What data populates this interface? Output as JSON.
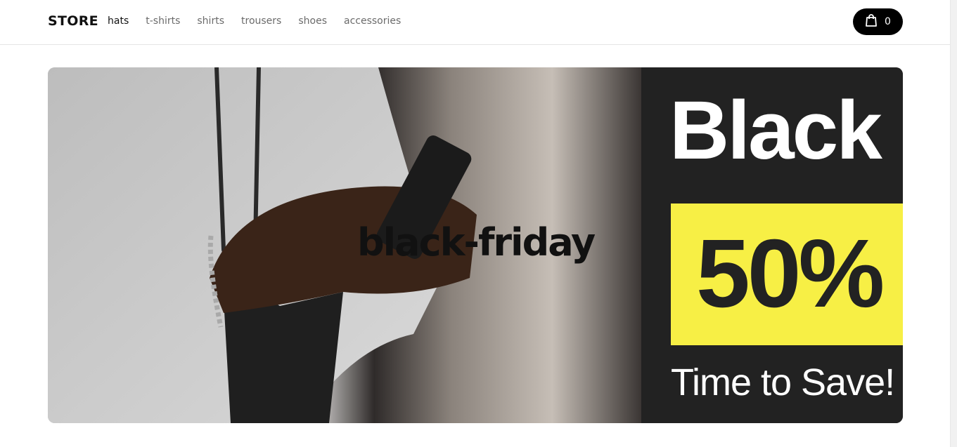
{
  "header": {
    "logo": "STORE",
    "nav": [
      {
        "label": "hats",
        "active": true
      },
      {
        "label": "t-shirts",
        "active": false
      },
      {
        "label": "shirts",
        "active": false
      },
      {
        "label": "trousers",
        "active": false
      },
      {
        "label": "shoes",
        "active": false
      },
      {
        "label": "accessories",
        "active": false
      }
    ],
    "cart": {
      "icon": "shopping-bag-icon",
      "count": "0"
    }
  },
  "banner": {
    "title": "black-friday",
    "promo": {
      "headline": "Black",
      "discount": "50%",
      "tagline": "Time to Save!",
      "accent_color": "#f7ef45",
      "panel_color": "#222222"
    }
  },
  "colors": {
    "background": "#ffffff",
    "cart_button": "#000000",
    "nav_active": "#111111",
    "nav_inactive": "#6b6b6b"
  }
}
